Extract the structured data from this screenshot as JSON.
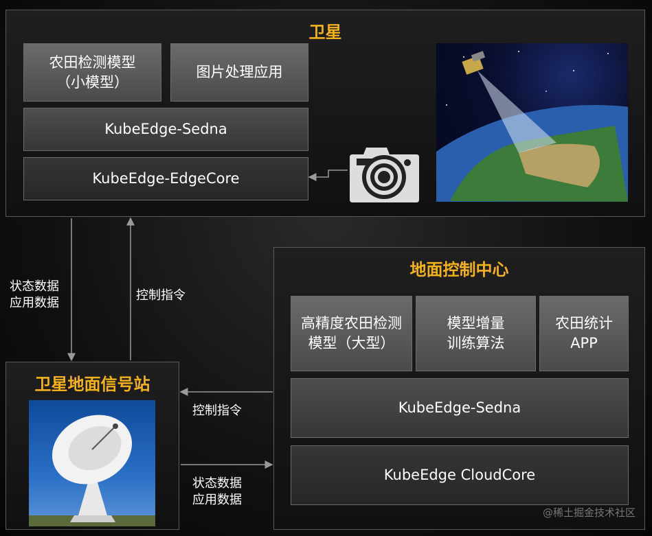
{
  "satellite": {
    "title": "卫星",
    "model_small_line1": "农田检测模型",
    "model_small_line2": "（小模型）",
    "image_app": "图片处理应用",
    "sedna": "KubeEdge-Sedna",
    "edgecore": "KubeEdge-EdgeCore"
  },
  "ground_center": {
    "title": "地面控制中心",
    "model_large_line1": "高精度农田检测",
    "model_large_line2": "模型（大型）",
    "training_line1": "模型增量",
    "training_line2": "训练算法",
    "stats_app_line1": "农田统计",
    "stats_app_line2": "APP",
    "sedna": "KubeEdge-Sedna",
    "cloudcore": "KubeEdge CloudCore"
  },
  "ground_station": {
    "title": "卫星地面信号站"
  },
  "links": {
    "status_data": "状态数据",
    "app_data": "应用数据",
    "control_cmd_1": "控制指令",
    "control_cmd_2": "控制指令",
    "status_data_2": "状态数据",
    "app_data_2": "应用数据"
  },
  "watermark": "@稀土掘金技术社区",
  "colors": {
    "title_accent": "#f2b21b",
    "panel_border": "#5a5a5a",
    "arrow": "#9a9a9a"
  }
}
